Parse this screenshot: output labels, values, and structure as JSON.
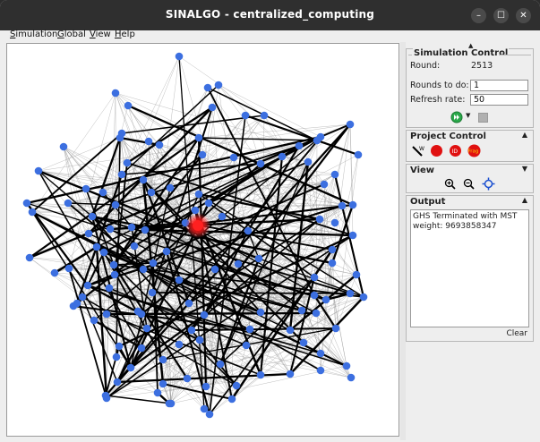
{
  "window": {
    "title": "SINALGO - centralized_computing",
    "minimize": "–",
    "maximize": "☐",
    "close": "✕"
  },
  "menu": [
    {
      "label": "Simulation",
      "key": "S",
      "rest": "imulation"
    },
    {
      "label": "Global",
      "key": "G",
      "rest": "lobal"
    },
    {
      "label": "View",
      "key": "V",
      "rest": "iew"
    },
    {
      "label": "Help",
      "key": "H",
      "rest": "elp"
    }
  ],
  "simulation_control": {
    "title": "Simulation Control",
    "round_label": "Round:",
    "round_value": "2513",
    "rounds_label": "Rounds to do:",
    "rounds_value": "1",
    "refresh_label": "Refresh rate:",
    "refresh_value": "50"
  },
  "project_control": {
    "title": "Project Control",
    "buttons": [
      "W",
      "",
      "ID",
      "Frag"
    ]
  },
  "view": {
    "title": "View"
  },
  "output": {
    "title": "Output",
    "text": "GHS Terminated with MST weight: 9693858347",
    "clear_label": "Clear"
  },
  "colors": {
    "node": "#3c6fe0",
    "highlight": "#ff2020",
    "mst_edge": "#000000",
    "edge": "#8a8a8a"
  }
}
